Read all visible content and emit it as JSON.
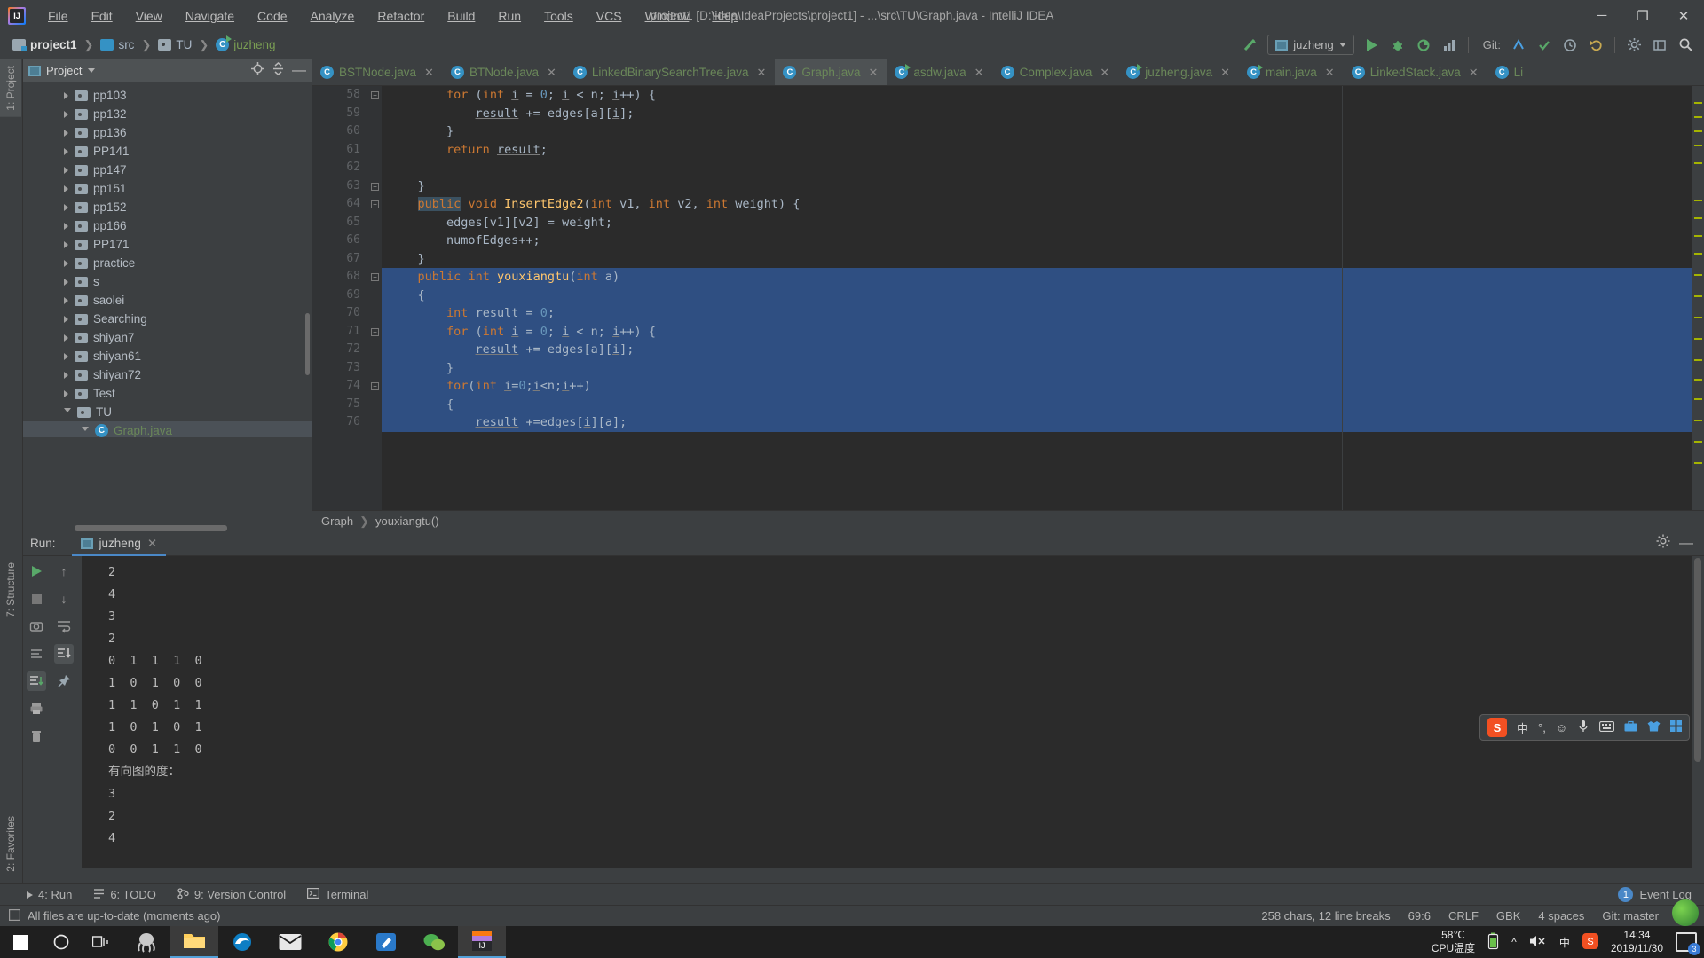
{
  "window": {
    "title": "project1 [D:\\idea\\IdeaProjects\\project1] - ...\\src\\TU\\Graph.java - IntelliJ IDEA",
    "minimize": "─",
    "maximize": "❐",
    "close": "✕"
  },
  "menu": [
    "File",
    "Edit",
    "View",
    "Navigate",
    "Code",
    "Analyze",
    "Refactor",
    "Build",
    "Run",
    "Tools",
    "VCS",
    "Window",
    "Help"
  ],
  "navbar": {
    "breadcrumbs": [
      {
        "label": "project1",
        "icon": "project-icon"
      },
      {
        "label": "src",
        "icon": "folder-icon"
      },
      {
        "label": "TU",
        "icon": "package-icon"
      },
      {
        "label": "juzheng",
        "icon": "class-run-icon"
      }
    ],
    "separator": "❯",
    "run_config": "juzheng",
    "git_label": "Git:",
    "icons": [
      "build-icon",
      "run-icon",
      "debug-icon",
      "coverage-icon",
      "profile-icon",
      "git-update-icon",
      "git-commit-icon",
      "git-history-icon",
      "undo-icon",
      "settings-icon",
      "layout-icon",
      "search-icon"
    ]
  },
  "left_strip": {
    "top": "1: Project",
    "middle": "7: Structure",
    "bottom": "2: Favorites"
  },
  "project_panel": {
    "title": "Project",
    "tree": [
      {
        "label": "pp103",
        "level": 3,
        "open": false,
        "selected": false
      },
      {
        "label": "pp132",
        "level": 3,
        "open": false,
        "selected": false
      },
      {
        "label": "pp136",
        "level": 3,
        "open": false,
        "selected": false
      },
      {
        "label": "PP141",
        "level": 3,
        "open": false,
        "selected": false
      },
      {
        "label": "pp147",
        "level": 3,
        "open": false,
        "selected": false
      },
      {
        "label": "pp151",
        "level": 3,
        "open": false,
        "selected": false
      },
      {
        "label": "pp152",
        "level": 3,
        "open": false,
        "selected": false
      },
      {
        "label": "pp166",
        "level": 3,
        "open": false,
        "selected": false
      },
      {
        "label": "PP171",
        "level": 3,
        "open": false,
        "selected": false
      },
      {
        "label": "practice",
        "level": 3,
        "open": false,
        "selected": false
      },
      {
        "label": "s",
        "level": 3,
        "open": false,
        "selected": false
      },
      {
        "label": "saolei",
        "level": 3,
        "open": false,
        "selected": false
      },
      {
        "label": "Searching",
        "level": 3,
        "open": false,
        "selected": false
      },
      {
        "label": "shiyan7",
        "level": 3,
        "open": false,
        "selected": false
      },
      {
        "label": "shiyan61",
        "level": 3,
        "open": false,
        "selected": false
      },
      {
        "label": "shiyan72",
        "level": 3,
        "open": false,
        "selected": false
      },
      {
        "label": "Test",
        "level": 3,
        "open": false,
        "selected": false
      },
      {
        "label": "TU",
        "level": 3,
        "open": true,
        "selected": false
      },
      {
        "label": "Graph.java",
        "level": 4,
        "open": true,
        "selected": true,
        "green": true
      }
    ]
  },
  "editor": {
    "tabs": [
      {
        "label": "BSTNode.java",
        "type": "class",
        "active": false
      },
      {
        "label": "BTNode.java",
        "type": "class",
        "active": false
      },
      {
        "label": "LinkedBinarySearchTree.java",
        "type": "class",
        "active": false
      },
      {
        "label": "Graph.java",
        "type": "class",
        "active": true
      },
      {
        "label": "asdw.java",
        "type": "class-run",
        "active": false
      },
      {
        "label": "Complex.java",
        "type": "class",
        "active": false
      },
      {
        "label": "juzheng.java",
        "type": "class-run",
        "active": false
      },
      {
        "label": "main.java",
        "type": "class-run",
        "active": false
      },
      {
        "label": "LinkedStack.java",
        "type": "class",
        "active": false
      },
      {
        "label": "Li",
        "type": "class",
        "active": false
      }
    ],
    "close_glyph": "✕",
    "first_line_number": 58,
    "lines": [
      {
        "n": 58,
        "selected": false,
        "fold": "bar",
        "tokens": [
          {
            "t": "        ",
            "c": ""
          },
          {
            "t": "for",
            "c": "kw"
          },
          {
            "t": " (",
            "c": ""
          },
          {
            "t": "int",
            "c": "kw"
          },
          {
            "t": " ",
            "c": ""
          },
          {
            "t": "i",
            "c": "var"
          },
          {
            "t": " = ",
            "c": ""
          },
          {
            "t": "0",
            "c": "num"
          },
          {
            "t": "; ",
            "c": ""
          },
          {
            "t": "i",
            "c": "var"
          },
          {
            "t": " < n; ",
            "c": ""
          },
          {
            "t": "i",
            "c": "var"
          },
          {
            "t": "++) {",
            "c": ""
          }
        ]
      },
      {
        "n": 59,
        "selected": false,
        "fold": "",
        "tokens": [
          {
            "t": "            ",
            "c": ""
          },
          {
            "t": "result",
            "c": "var"
          },
          {
            "t": " += edges[a][",
            "c": ""
          },
          {
            "t": "i",
            "c": "var"
          },
          {
            "t": "];",
            "c": ""
          }
        ]
      },
      {
        "n": 60,
        "selected": false,
        "fold": "",
        "tokens": [
          {
            "t": "        }",
            "c": ""
          }
        ]
      },
      {
        "n": 61,
        "selected": false,
        "fold": "",
        "tokens": [
          {
            "t": "        ",
            "c": ""
          },
          {
            "t": "return",
            "c": "kw"
          },
          {
            "t": " ",
            "c": ""
          },
          {
            "t": "result",
            "c": "var"
          },
          {
            "t": ";",
            "c": ""
          }
        ]
      },
      {
        "n": 62,
        "selected": false,
        "fold": "",
        "tokens": [
          {
            "t": "",
            "c": ""
          }
        ]
      },
      {
        "n": 63,
        "selected": false,
        "fold": "bar",
        "tokens": [
          {
            "t": "    }",
            "c": ""
          }
        ]
      },
      {
        "n": 64,
        "selected": false,
        "fold": "bar",
        "tokens": [
          {
            "t": "    ",
            "c": ""
          },
          {
            "t": "public",
            "c": "kwhl"
          },
          {
            "t": " ",
            "c": ""
          },
          {
            "t": "void",
            "c": "kw"
          },
          {
            "t": " ",
            "c": ""
          },
          {
            "t": "InsertEdge2",
            "c": "fn"
          },
          {
            "t": "(",
            "c": ""
          },
          {
            "t": "int",
            "c": "kw"
          },
          {
            "t": " v1, ",
            "c": ""
          },
          {
            "t": "int",
            "c": "kw"
          },
          {
            "t": " v2, ",
            "c": ""
          },
          {
            "t": "int",
            "c": "kw"
          },
          {
            "t": " weight) {",
            "c": ""
          }
        ]
      },
      {
        "n": 65,
        "selected": false,
        "fold": "",
        "tokens": [
          {
            "t": "        edges[v1][v2] = weight;",
            "c": ""
          }
        ]
      },
      {
        "n": 66,
        "selected": false,
        "fold": "",
        "tokens": [
          {
            "t": "        numofEdges++;",
            "c": ""
          }
        ]
      },
      {
        "n": 67,
        "selected": false,
        "fold": "",
        "tokens": [
          {
            "t": "    }",
            "c": ""
          }
        ]
      },
      {
        "n": 68,
        "selected": true,
        "fold": "bar",
        "tokens": [
          {
            "t": "    ",
            "c": ""
          },
          {
            "t": "public",
            "c": "kw"
          },
          {
            "t": " ",
            "c": ""
          },
          {
            "t": "int",
            "c": "kw"
          },
          {
            "t": " ",
            "c": ""
          },
          {
            "t": "youxiangtu",
            "c": "fn"
          },
          {
            "t": "(",
            "c": ""
          },
          {
            "t": "int",
            "c": "kw"
          },
          {
            "t": " a)",
            "c": ""
          }
        ]
      },
      {
        "n": 69,
        "selected": true,
        "fold": "",
        "tokens": [
          {
            "t": "    {",
            "c": ""
          }
        ]
      },
      {
        "n": 70,
        "selected": true,
        "fold": "",
        "tokens": [
          {
            "t": "        ",
            "c": ""
          },
          {
            "t": "int",
            "c": "kw"
          },
          {
            "t": " ",
            "c": ""
          },
          {
            "t": "result",
            "c": "var"
          },
          {
            "t": " = ",
            "c": ""
          },
          {
            "t": "0",
            "c": "num"
          },
          {
            "t": ";",
            "c": ""
          }
        ]
      },
      {
        "n": 71,
        "selected": true,
        "fold": "bar",
        "tokens": [
          {
            "t": "        ",
            "c": ""
          },
          {
            "t": "for",
            "c": "kw"
          },
          {
            "t": " (",
            "c": ""
          },
          {
            "t": "int",
            "c": "kw"
          },
          {
            "t": " ",
            "c": ""
          },
          {
            "t": "i",
            "c": "var"
          },
          {
            "t": " = ",
            "c": ""
          },
          {
            "t": "0",
            "c": "num"
          },
          {
            "t": "; ",
            "c": ""
          },
          {
            "t": "i",
            "c": "var"
          },
          {
            "t": " < n; ",
            "c": ""
          },
          {
            "t": "i",
            "c": "var"
          },
          {
            "t": "++) {",
            "c": ""
          }
        ]
      },
      {
        "n": 72,
        "selected": true,
        "fold": "",
        "tokens": [
          {
            "t": "            ",
            "c": ""
          },
          {
            "t": "result",
            "c": "var"
          },
          {
            "t": " += edges[a][",
            "c": ""
          },
          {
            "t": "i",
            "c": "var"
          },
          {
            "t": "];",
            "c": ""
          }
        ]
      },
      {
        "n": 73,
        "selected": true,
        "fold": "",
        "tokens": [
          {
            "t": "        }",
            "c": ""
          }
        ]
      },
      {
        "n": 74,
        "selected": true,
        "fold": "bar",
        "tokens": [
          {
            "t": "        ",
            "c": ""
          },
          {
            "t": "for",
            "c": "kw"
          },
          {
            "t": "(",
            "c": ""
          },
          {
            "t": "int",
            "c": "kw"
          },
          {
            "t": " ",
            "c": ""
          },
          {
            "t": "i",
            "c": "var"
          },
          {
            "t": "=",
            "c": ""
          },
          {
            "t": "0",
            "c": "num"
          },
          {
            "t": ";",
            "c": ""
          },
          {
            "t": "i",
            "c": "var"
          },
          {
            "t": "<n;",
            "c": ""
          },
          {
            "t": "i",
            "c": "var"
          },
          {
            "t": "++)",
            "c": ""
          }
        ]
      },
      {
        "n": 75,
        "selected": true,
        "fold": "",
        "tokens": [
          {
            "t": "        {",
            "c": ""
          }
        ]
      },
      {
        "n": 76,
        "selected": true,
        "fold": "",
        "tokens": [
          {
            "t": "            ",
            "c": ""
          },
          {
            "t": "result",
            "c": "var"
          },
          {
            "t": " +=edges[",
            "c": ""
          },
          {
            "t": "i",
            "c": "var"
          },
          {
            "t": "][a];",
            "c": ""
          }
        ]
      }
    ],
    "breadcrumb": [
      "Graph",
      "youxiangtu()"
    ],
    "breadcrumb_sep": "❯"
  },
  "run_window": {
    "label": "Run:",
    "tab": "juzheng",
    "close_glyph": "✕",
    "console_lines": [
      "2",
      "4",
      "3",
      "2",
      "0  1  1  1  0",
      "1  0  1  0  0",
      "1  1  0  1  1",
      "1  0  1  0  1",
      "0  0  1  1  0",
      "有向图的度：",
      "3",
      "2",
      "4"
    ]
  },
  "bottom_tabs": [
    {
      "label": "4: Run",
      "icon": "run-icon"
    },
    {
      "label": "6: TODO",
      "icon": "todo-icon"
    },
    {
      "label": "9: Version Control",
      "icon": "vcs-icon"
    },
    {
      "label": "Terminal",
      "icon": "terminal-icon"
    }
  ],
  "event_log": {
    "count": "1",
    "label": "Event Log"
  },
  "statusbar": {
    "message": "All files are up-to-date (moments ago)",
    "chars": "258 chars, 12 line breaks",
    "caret": "69:6",
    "line_sep": "CRLF",
    "encoding": "GBK",
    "indent": "4 spaces",
    "git": "Git: master",
    "lock_icon": "lock-icon"
  },
  "ime": {
    "logo": "S",
    "mode": "中",
    "items": [
      "comma-icon",
      "emoji-icon",
      "mic-icon",
      "keyboard-icon",
      "toolbox-icon",
      "shirt-icon",
      "grid-icon"
    ]
  },
  "taskbar": {
    "start": "start-icon",
    "items": [
      "cortana-icon",
      "taskview-icon",
      "octopus-icon",
      "file-explorer-icon",
      "edge-icon",
      "mail-icon",
      "chrome-icon",
      "editor-icon",
      "wechat-icon",
      "intellij-icon"
    ],
    "cpu_temp": "58℃",
    "cpu_label": "CPU温度",
    "time": "14:34",
    "date": "2019/11/30",
    "tray_icons": [
      "battery-icon",
      "chevron-up-icon",
      "volume-icon",
      "ime-cn-icon",
      "sogou-icon",
      "notification-icon"
    ]
  }
}
